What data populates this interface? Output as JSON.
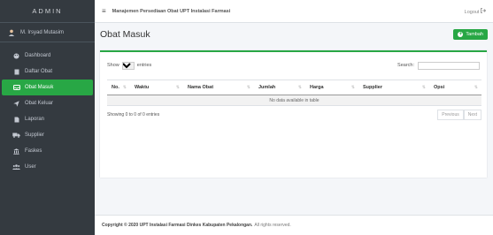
{
  "sidebar": {
    "brand": "ADMIN",
    "user_name": "M. Irsyad Mutasim",
    "items": [
      {
        "label": "Dashboard",
        "icon": "palette-icon",
        "active": false
      },
      {
        "label": "Daftar Obat",
        "icon": "book-icon",
        "active": false
      },
      {
        "label": "Obat Masuk",
        "icon": "inbox-icon",
        "active": true
      },
      {
        "label": "Obat Keluar",
        "icon": "paper-plane-icon",
        "active": false
      },
      {
        "label": "Laporan",
        "icon": "file-icon",
        "active": false
      },
      {
        "label": "Supplier",
        "icon": "truck-icon",
        "active": false
      },
      {
        "label": "Faskes",
        "icon": "building-icon",
        "active": false
      },
      {
        "label": "User",
        "icon": "users-icon",
        "active": false
      }
    ]
  },
  "topbar": {
    "title": "Manajemen Persediaan Obat UPT Instalasi Farmasi",
    "logout": "Logout"
  },
  "page": {
    "title": "Obat Masuk",
    "add_button": "Tambah"
  },
  "table": {
    "show_label": "Show",
    "entries_value": "10",
    "entries_label": "entries",
    "search_label": "Search:",
    "columns": [
      "No.",
      "Waktu",
      "Nama Obat",
      "Jumlah",
      "Harga",
      "Supplier",
      "Opsi"
    ],
    "empty_text": "No data available in table",
    "info": "Showing 0 to 0 of 0 entries",
    "prev": "Previous",
    "next": "Next"
  },
  "footer": {
    "copyright": "Copyright © 2020 UPT Instalasi Farmasi Dinkes Kabupaten Pekalongan.",
    "rights": "All rights reserved."
  },
  "colors": {
    "accent": "#28a745",
    "sidebar_bg": "#343a40"
  }
}
